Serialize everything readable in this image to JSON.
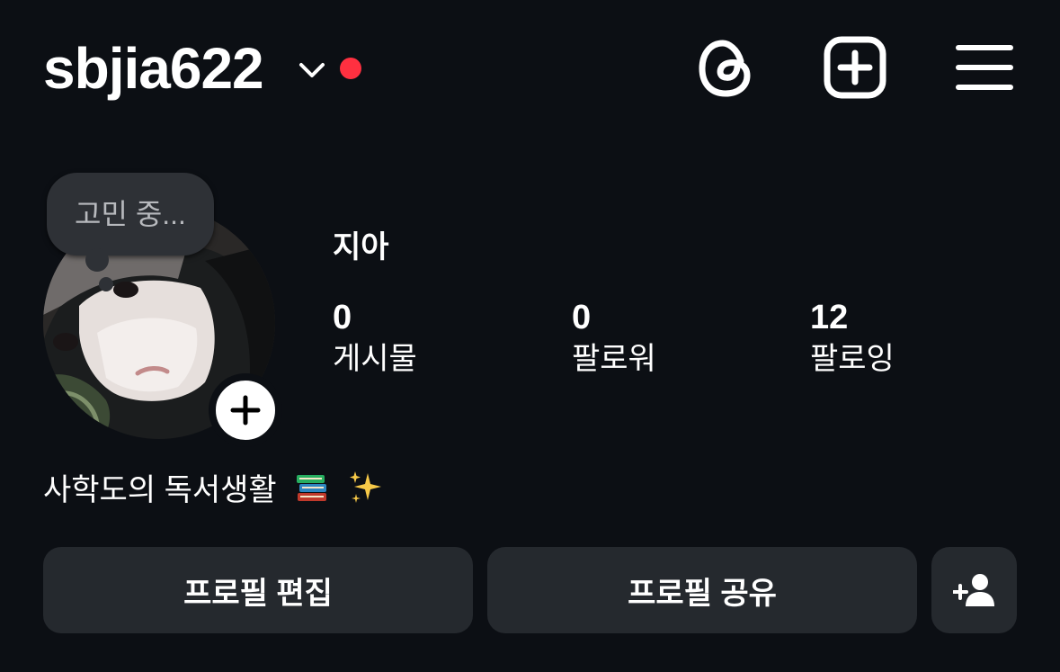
{
  "header": {
    "username": "sbjia622",
    "icons": [
      "chevron-down-icon",
      "threads-icon",
      "create-post-icon",
      "hamburger-menu-icon"
    ],
    "notification_dot_color": "#ff3040"
  },
  "note": {
    "text": "고민 중..."
  },
  "profile": {
    "display_name": "지아",
    "stats": [
      {
        "value": "0",
        "label": "게시물"
      },
      {
        "value": "0",
        "label": "팔로워"
      },
      {
        "value": "12",
        "label": "팔로잉"
      }
    ],
    "bio": "사학도의 독서생활",
    "bio_emojis": [
      "books-emoji",
      "sparkles-emoji"
    ]
  },
  "actions": {
    "edit_profile": "프로필 편집",
    "share_profile": "프로필 공유",
    "discover_people_icon": "add-person-icon"
  },
  "colors": {
    "background": "#0c0f14",
    "button": "#25292e",
    "text": "#ffffff",
    "note_bubble": "#2e3136"
  }
}
